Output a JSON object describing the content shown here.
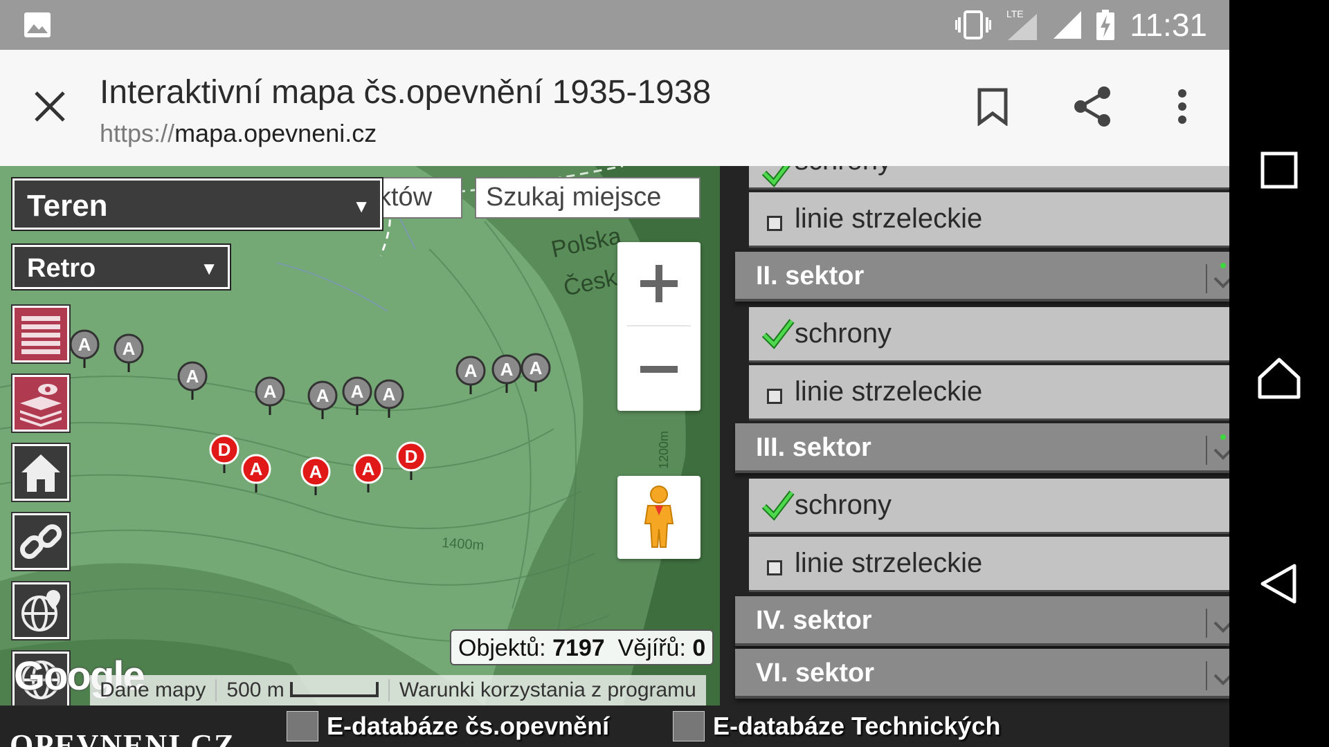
{
  "status_bar": {
    "time": "11:31",
    "network": "LTE"
  },
  "browser": {
    "title": "Interaktivní mapa čs.opevnění 1935-1938",
    "url_protocol": "https://",
    "url_host": "mapa.opevneni.cz"
  },
  "map": {
    "map_type_select": "Teren",
    "style_select": "Retro",
    "object_search_partial": "któw",
    "place_search_placeholder": "Szukaj miejsce",
    "labels": {
      "country_pl": "Polska",
      "country_cz": "Česk",
      "contour_1": "1400m",
      "contour_2": "1200m"
    },
    "counter": {
      "objects_label": "Objektů:",
      "objects_value": "7197",
      "fans_label": "Vějířů:",
      "fans_value": "0"
    },
    "attribution": {
      "map_data": "Dane mapy",
      "scale": "500 m",
      "terms": "Warunki korzystania z programu"
    },
    "google_logo": "Google",
    "markers": [
      {
        "letter": "A",
        "color": "gray"
      },
      {
        "letter": "A",
        "color": "gray"
      },
      {
        "letter": "A",
        "color": "gray"
      },
      {
        "letter": "A",
        "color": "gray"
      },
      {
        "letter": "A",
        "color": "gray"
      },
      {
        "letter": "A",
        "color": "gray"
      },
      {
        "letter": "A",
        "color": "gray"
      },
      {
        "letter": "A",
        "color": "gray"
      },
      {
        "letter": "A",
        "color": "gray"
      },
      {
        "letter": "A",
        "color": "gray"
      },
      {
        "letter": "D",
        "color": "red"
      },
      {
        "letter": "A",
        "color": "red"
      },
      {
        "letter": "A",
        "color": "red"
      },
      {
        "letter": "A",
        "color": "red"
      },
      {
        "letter": "D",
        "color": "red"
      }
    ]
  },
  "side_buttons": [
    "list-icon",
    "layers-eye-icon",
    "home-icon",
    "link-icon",
    "globe-location-icon",
    "globe-icon"
  ],
  "panel": {
    "partial_row": "schrony",
    "rows": [
      {
        "type": "item",
        "label": "linie strzeleckie",
        "checked": false
      },
      {
        "type": "header",
        "label": "II. sektor"
      },
      {
        "type": "item",
        "label": "schrony",
        "checked": true
      },
      {
        "type": "item",
        "label": "linie strzeleckie",
        "checked": false
      },
      {
        "type": "header",
        "label": "III. sektor"
      },
      {
        "type": "item",
        "label": "schrony",
        "checked": true
      },
      {
        "type": "item",
        "label": "linie strzeleckie",
        "checked": false
      },
      {
        "type": "header",
        "label": "IV. sektor"
      },
      {
        "type": "header",
        "label": "VI. sektor"
      }
    ]
  },
  "footer": {
    "logo": "OPEVNENI.CZ",
    "link1": "E-databáze čs.opevnění",
    "link2": "E-databáze Technických"
  },
  "colors": {
    "status_bar": "#9a9a9a",
    "tab_bar": "#f7f7f7",
    "map_green": "#6a9a6a",
    "marker_red": "#e01818",
    "sector_header": "#8a8a8a",
    "row_bg": "#c3c3c3"
  }
}
